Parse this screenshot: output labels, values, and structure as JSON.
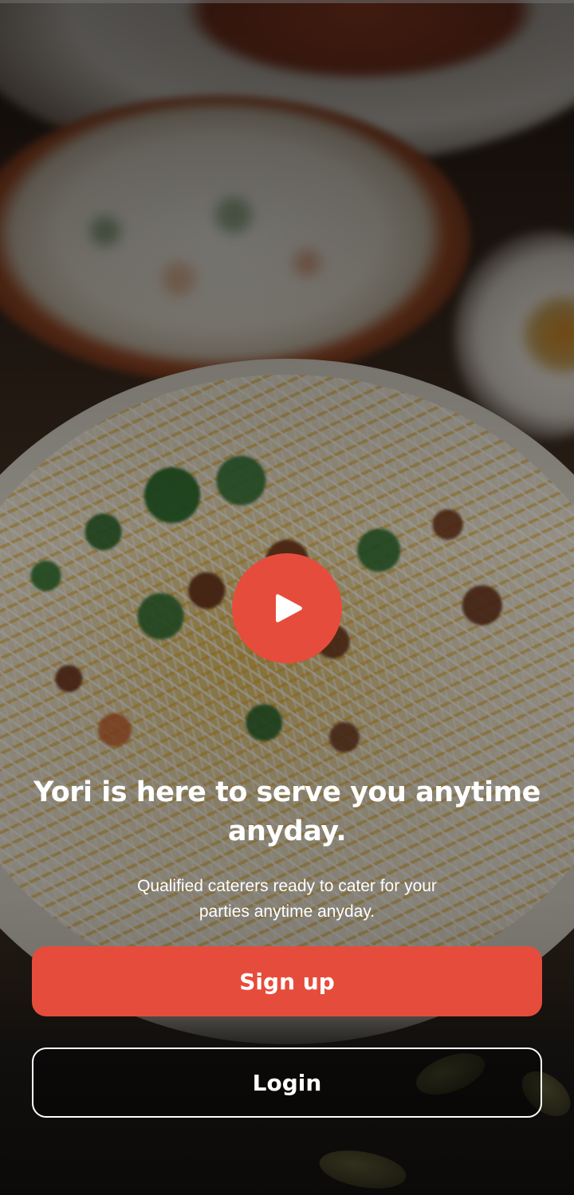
{
  "app": {
    "name": "Yori"
  },
  "hero": {
    "background_image": "biryani-rice-plate",
    "play_icon": "play-icon",
    "headline": "Yori is here to serve you anytime anyday.",
    "subtext": "Qualified caterers ready to cater for your parties anytime anyday."
  },
  "actions": {
    "signup_label": "Sign up",
    "login_label": "Login"
  },
  "colors": {
    "accent": "#e64c3c",
    "text": "#ffffff",
    "overlay": "rgba(0,0,0,0.5)"
  }
}
